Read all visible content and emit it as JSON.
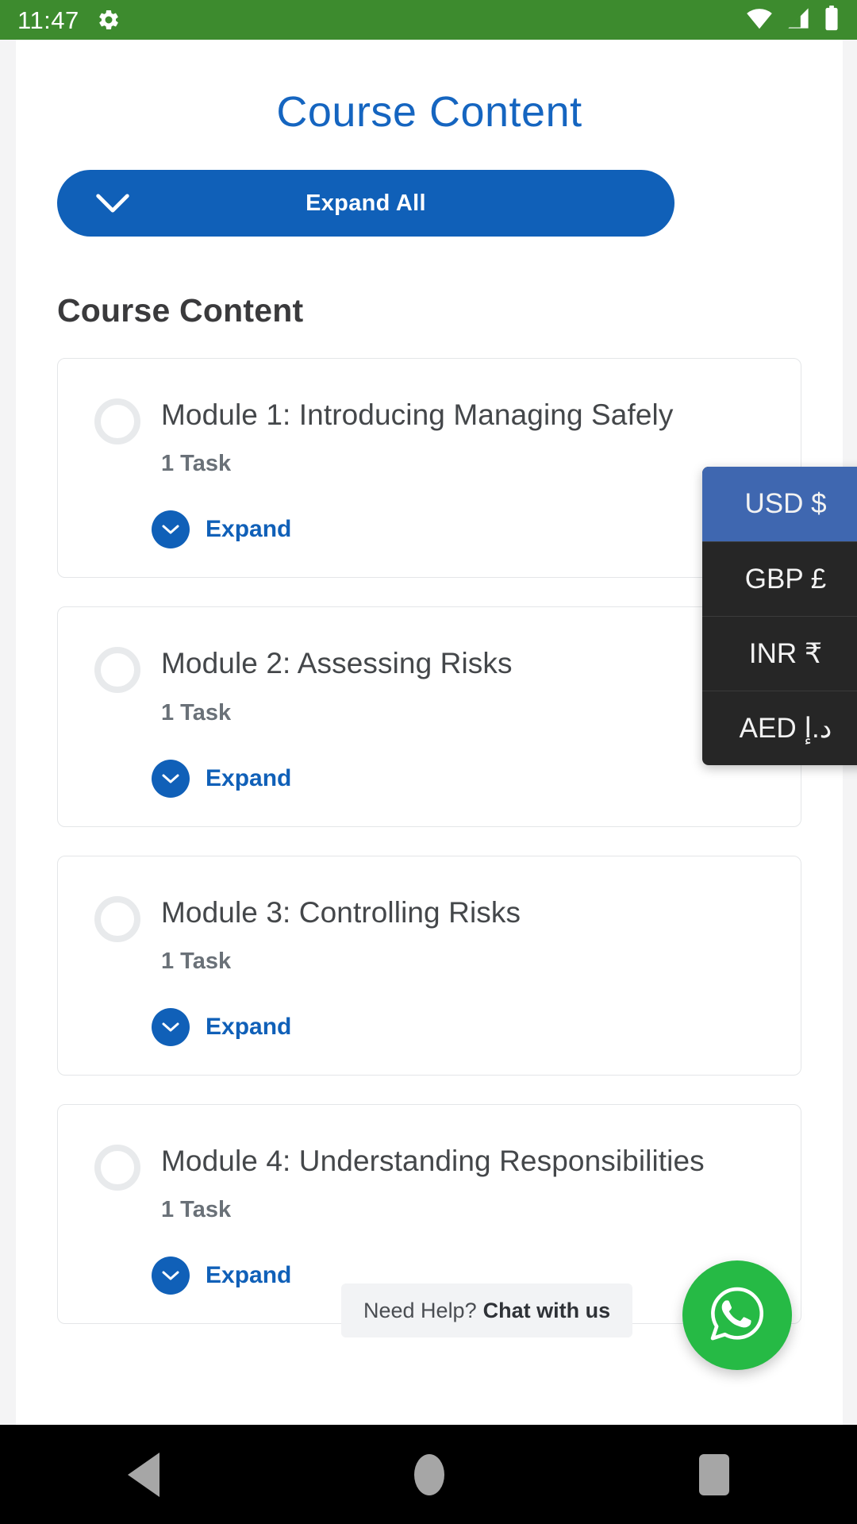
{
  "status_bar": {
    "time": "11:47",
    "icons": [
      "gear-icon",
      "wifi-icon",
      "cellular-signal-icon",
      "battery-icon"
    ],
    "background_color": "#3d8b2e"
  },
  "page": {
    "title": "Course Content",
    "title_color": "#1565c0",
    "expand_all_button": {
      "label": "Expand All",
      "icon": "chevron-down-icon",
      "background_color": "#1060b8"
    },
    "section_heading": "Course Content",
    "modules": [
      {
        "title": "Module 1: Introducing Managing Safely",
        "tasks": "1 Task",
        "expand_label": "Expand",
        "status_icon": "empty-circle-icon"
      },
      {
        "title": "Module 2: Assessing Risks",
        "tasks": "1 Task",
        "expand_label": "Expand",
        "status_icon": "empty-circle-icon"
      },
      {
        "title": "Module 3: Controlling Risks",
        "tasks": "1 Task",
        "expand_label": "Expand",
        "status_icon": "empty-circle-icon"
      },
      {
        "title": "Module 4: Understanding Responsibilities",
        "tasks": "1 Task",
        "expand_label": "Expand",
        "status_icon": "empty-circle-icon"
      }
    ]
  },
  "currency_menu": {
    "selected": "USD $",
    "selected_color": "#3f67b0",
    "background_color": "#262626",
    "items": [
      {
        "label": "USD $",
        "selected": true
      },
      {
        "label": "GBP £",
        "selected": false
      },
      {
        "label": "INR ₹",
        "selected": false
      },
      {
        "label": "AED د.إ",
        "selected": false
      }
    ]
  },
  "chat_widget": {
    "prompt": "Need Help?",
    "action": "Chat with us",
    "icon": "whatsapp-icon",
    "fab_color": "#26ba45"
  },
  "nav_bar": {
    "back": "back-triangle-icon",
    "home": "home-circle-icon",
    "recents": "recents-square-icon"
  }
}
